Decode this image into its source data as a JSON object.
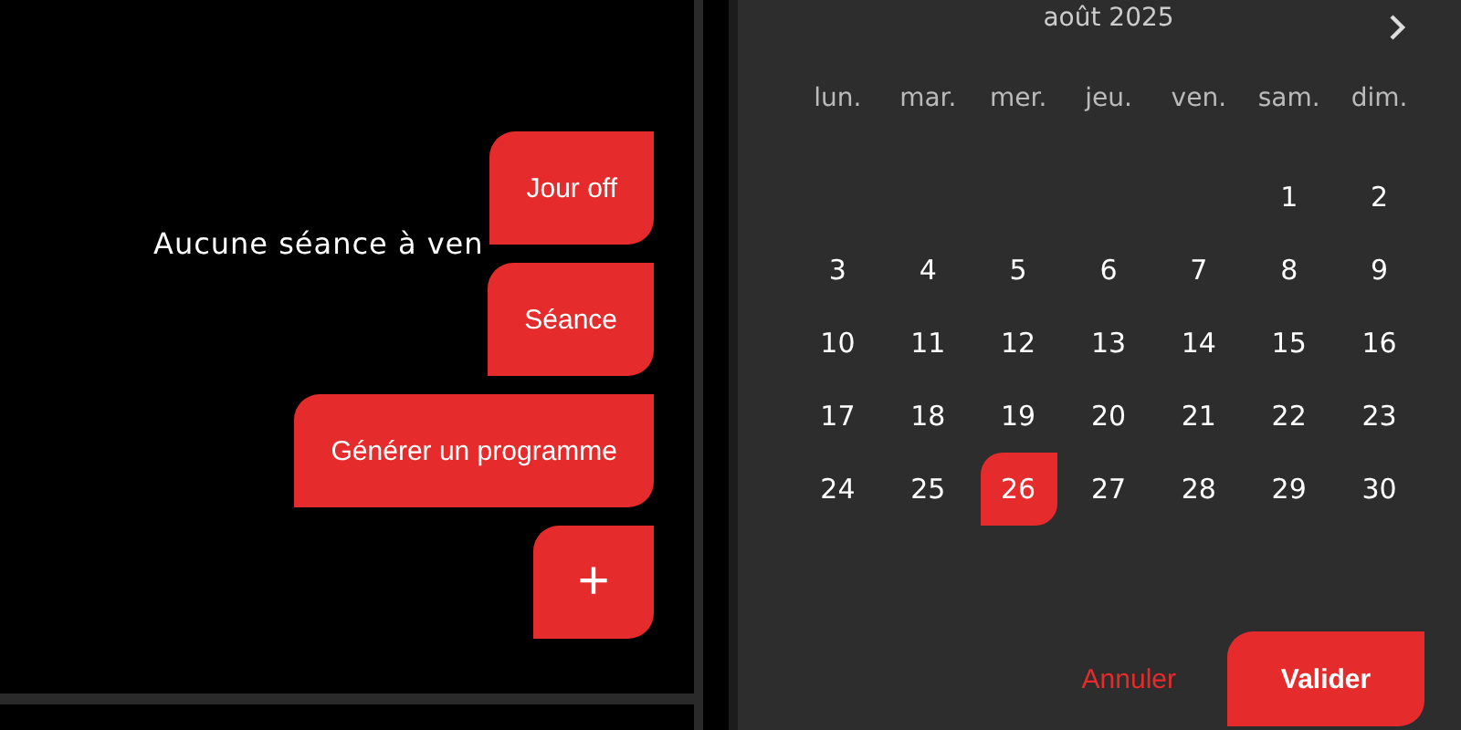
{
  "session_screen": {
    "empty_message": "Aucune séance à ven",
    "fab_actions": [
      {
        "kind": "text",
        "label": "Jour off"
      },
      {
        "kind": "text",
        "label": "Séance"
      },
      {
        "kind": "text",
        "label": "Générer un programme"
      },
      {
        "kind": "plus",
        "label": "+"
      }
    ]
  },
  "date_picker": {
    "month": "août 2025",
    "weekdays": [
      "lun.",
      "mar.",
      "mer.",
      "jeu.",
      "ven.",
      "sam.",
      "dim."
    ],
    "weeks": [
      [
        {
          "day": "1",
          "selected": false
        },
        {
          "day": "2",
          "selected": false
        }
      ],
      [
        {
          "day": "3",
          "selected": false
        },
        {
          "day": "4",
          "selected": false
        },
        {
          "day": "5",
          "selected": false
        },
        {
          "day": "6",
          "selected": false
        },
        {
          "day": "7",
          "selected": false
        },
        {
          "day": "8",
          "selected": false
        },
        {
          "day": "9",
          "selected": false
        }
      ],
      [
        {
          "day": "10",
          "selected": false
        },
        {
          "day": "11",
          "selected": false
        },
        {
          "day": "12",
          "selected": false
        },
        {
          "day": "13",
          "selected": false
        },
        {
          "day": "14",
          "selected": false
        },
        {
          "day": "15",
          "selected": false
        },
        {
          "day": "16",
          "selected": false
        }
      ],
      [
        {
          "day": "17",
          "selected": false
        },
        {
          "day": "18",
          "selected": false
        },
        {
          "day": "19",
          "selected": false
        },
        {
          "day": "20",
          "selected": false
        },
        {
          "day": "21",
          "selected": false
        },
        {
          "day": "22",
          "selected": false
        },
        {
          "day": "23",
          "selected": false
        }
      ],
      [
        {
          "day": "24",
          "selected": false
        },
        {
          "day": "25",
          "selected": false
        },
        {
          "day": "26",
          "selected": true
        },
        {
          "day": "27",
          "selected": false
        },
        {
          "day": "28",
          "selected": false
        },
        {
          "day": "29",
          "selected": false
        },
        {
          "day": "30",
          "selected": false
        }
      ]
    ],
    "cancel": "Annuler",
    "confirm": "Valider"
  }
}
